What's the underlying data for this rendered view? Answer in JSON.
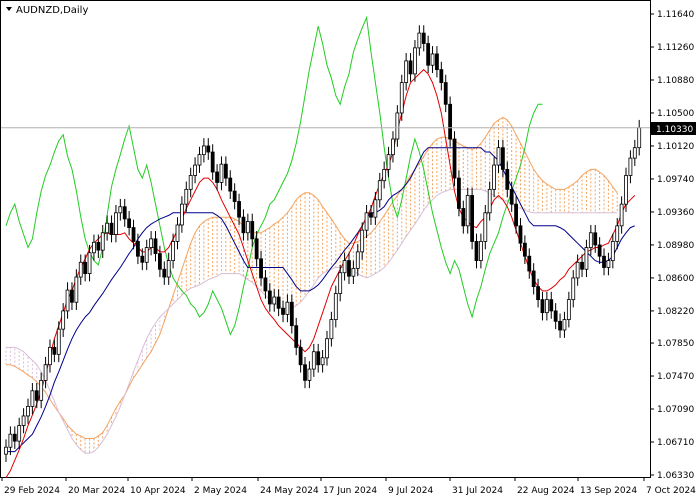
{
  "chart_data": {
    "type": "candlestick",
    "title": "AUDNZD,Daily",
    "current_price": "1.10330",
    "y_ticks": [
      "1.11640",
      "1.11260",
      "1.10880",
      "1.10500",
      "1.10120",
      "1.09740",
      "1.09360",
      "1.08980",
      "1.08600",
      "1.08220",
      "1.07850",
      "1.07470",
      "1.07090",
      "1.06710",
      "1.06330"
    ],
    "ylim": [
      1.0633,
      1.1164
    ],
    "x_ticks": [
      "29 Feb 2024",
      "20 Mar 2024",
      "10 Apr 2024",
      "2 May 2024",
      "24 May 2024",
      "17 Jun 2024",
      "9 Jul 2024",
      "31 Jul 2024",
      "22 Aug 2024",
      "13 Sep 2024",
      "7 Oct 2024"
    ],
    "closes": [
      1.0665,
      1.068,
      1.0672,
      1.069,
      1.0701,
      1.0712,
      1.073,
      1.0719,
      1.0742,
      1.076,
      1.078,
      1.0772,
      1.0801,
      1.0822,
      1.0846,
      1.0832,
      1.0861,
      1.0878,
      1.0865,
      1.0889,
      1.0901,
      1.0892,
      1.0912,
      1.0923,
      1.091,
      1.0935,
      1.0942,
      1.0928,
      1.0918,
      1.0902,
      1.0885,
      1.0878,
      1.0895,
      1.0905,
      1.0888,
      1.087,
      1.0861,
      1.088,
      1.0902,
      1.0921,
      1.0945,
      1.0962,
      1.0978,
      1.099,
      1.1002,
      1.1012,
      1.1005,
      1.0982,
      1.097,
      1.0991,
      1.0975,
      1.096,
      1.0948,
      1.093,
      1.0912,
      1.0925,
      1.0905,
      1.0882,
      1.086,
      1.0845,
      1.083,
      1.0838,
      1.0825,
      1.0818,
      1.0832,
      1.0805,
      1.078,
      1.076,
      1.0742,
      1.0755,
      1.0775,
      1.076,
      1.0768,
      1.079,
      1.0812,
      1.0842,
      1.0866,
      1.088,
      1.0862,
      1.0871,
      1.089,
      1.0915,
      1.0935,
      1.093,
      1.095,
      1.0972,
      1.0985,
      1.1002,
      1.102,
      1.105,
      1.1085,
      1.111,
      1.1095,
      1.1125,
      1.1142,
      1.113,
      1.1105,
      1.1118,
      1.11,
      1.1085,
      1.106,
      1.102,
      1.0975,
      1.094,
      1.092,
      1.0955,
      1.0902,
      1.088,
      1.0902,
      1.0935,
      1.0962,
      1.099,
      1.101,
      1.0985,
      1.0962,
      1.0945,
      1.092,
      1.09,
      1.0885,
      1.0868,
      1.085,
      1.0835,
      1.082,
      1.0835,
      1.0822,
      1.081,
      1.08,
      1.0812,
      1.0835,
      1.086,
      1.0878,
      1.087,
      1.0895,
      1.0912,
      1.0898,
      1.0885,
      1.0872,
      1.088,
      1.0902,
      1.092,
      1.0945,
      1.0978,
      1.0998,
      1.101,
      1.1033
    ],
    "tenkan": [
      1.063,
      1.0638,
      1.065,
      1.0662,
      1.0675,
      1.069,
      1.0702,
      1.0715,
      1.073,
      1.0748,
      1.077,
      1.079,
      1.0805,
      1.082,
      1.0835,
      1.0845,
      1.086,
      1.0872,
      1.0882,
      1.0893,
      1.09,
      1.0905,
      1.091,
      1.0912,
      1.091,
      1.091,
      1.091,
      1.0912,
      1.0905,
      1.09,
      1.0895,
      1.089,
      1.089,
      1.0895,
      1.0895,
      1.089,
      1.089,
      1.0895,
      1.0905,
      1.0915,
      1.0928,
      1.094,
      1.095,
      1.096,
      1.097,
      1.0975,
      1.0975,
      1.097,
      1.0962,
      1.095,
      1.094,
      1.093,
      1.092,
      1.091,
      1.0895,
      1.088,
      1.0865,
      1.085,
      1.0835,
      1.0825,
      1.0818,
      1.0812,
      1.0805,
      1.08,
      1.0795,
      1.079,
      1.0785,
      1.078,
      1.0775,
      1.078,
      1.079,
      1.0805,
      1.082,
      1.0835,
      1.085,
      1.086,
      1.087,
      1.088,
      1.0888,
      1.0898,
      1.091,
      1.092,
      1.093,
      1.094,
      1.0955,
      1.0968,
      1.098,
      1.099,
      1.1005,
      1.103,
      1.105,
      1.107,
      1.1085,
      1.109,
      1.1095,
      1.11,
      1.1095,
      1.1085,
      1.107,
      1.105,
      1.102,
      1.099,
      1.096,
      1.094,
      1.093,
      1.0925,
      1.092,
      1.0918,
      1.0925,
      1.093,
      1.094,
      1.095,
      1.0955,
      1.095,
      1.0942,
      1.093,
      1.0915,
      1.09,
      1.0885,
      1.087,
      1.0858,
      1.085,
      1.0845,
      1.0845,
      1.0848,
      1.0852,
      1.0858,
      1.0862,
      1.087,
      1.0875,
      1.088,
      1.0885,
      1.089,
      1.0892,
      1.0895,
      1.0895,
      1.0898,
      1.09,
      1.091,
      1.092,
      1.0935,
      1.0945,
      1.095,
      1.0955
    ],
    "kijun": [
      1.066,
      1.066,
      1.066,
      1.0665,
      1.067,
      1.0675,
      1.068,
      1.069,
      1.07,
      1.0712,
      1.0725,
      1.074,
      1.0752,
      1.0765,
      1.0778,
      1.079,
      1.08,
      1.0808,
      1.0815,
      1.082,
      1.0828,
      1.0835,
      1.0842,
      1.085,
      1.0858,
      1.0865,
      1.0872,
      1.088,
      1.0888,
      1.0895,
      1.0905,
      1.0912,
      1.0918,
      1.0922,
      1.0925,
      1.0928,
      1.093,
      1.0932,
      1.0935,
      1.0935,
      1.0935,
      1.0935,
      1.0935,
      1.0935,
      1.0935,
      1.0935,
      1.0935,
      1.0935,
      1.0932,
      1.0928,
      1.092,
      1.091,
      1.09,
      1.089,
      1.088,
      1.0872,
      1.0872,
      1.0872,
      1.0872,
      1.0872,
      1.0872,
      1.0872,
      1.0872,
      1.0872,
      1.0865,
      1.0858,
      1.085,
      1.0845,
      1.0845,
      1.0845,
      1.0848,
      1.0852,
      1.0858,
      1.0865,
      1.0872,
      1.0878,
      1.0885,
      1.0892,
      1.0898,
      1.0905,
      1.0912,
      1.092,
      1.093,
      1.0935,
      1.0935,
      1.0938,
      1.0942,
      1.095,
      1.0955,
      1.0958,
      1.0962,
      1.0968,
      1.0975,
      1.0985,
      1.0995,
      1.1005,
      1.101,
      1.101,
      1.101,
      1.101,
      1.101,
      1.101,
      1.101,
      1.101,
      1.101,
      1.101,
      1.101,
      1.101,
      1.101,
      1.1005,
      1.1005,
      1.1,
      1.0995,
      1.0985,
      1.0975,
      1.0965,
      1.0955,
      1.0945,
      1.0935,
      1.0925,
      1.092,
      1.092,
      1.092,
      1.092,
      1.092,
      1.092,
      1.0918,
      1.0915,
      1.091,
      1.0905,
      1.09,
      1.0895,
      1.089,
      1.0885,
      1.088,
      1.0878,
      1.0878,
      1.088,
      1.0885,
      1.0895,
      1.0905,
      1.0912,
      1.0918,
      1.092
    ],
    "chikou": [
      1.092,
      1.0935,
      1.0945,
      1.0925,
      1.091,
      1.0895,
      1.0905,
      1.0935,
      1.096,
      1.0978,
      1.099,
      1.1005,
      1.1018,
      1.1025,
      1.1,
      1.0985,
      1.096,
      1.093,
      1.0905,
      1.089,
      1.088,
      1.0875,
      1.0895,
      1.0932,
      1.0965,
      1.0985,
      1.1002,
      1.102,
      1.1035,
      1.101,
      1.0985,
      1.0975,
      1.099,
      1.097,
      1.0945,
      1.092,
      1.0895,
      1.0875,
      1.086,
      1.0852,
      1.0845,
      1.084,
      1.083,
      1.0825,
      1.0815,
      1.082,
      1.083,
      1.0845,
      1.0835,
      1.0825,
      1.081,
      1.0795,
      1.0805,
      1.0825,
      1.085,
      1.087,
      1.0895,
      1.091,
      1.092,
      1.093,
      1.0945,
      1.095,
      1.096,
      1.097,
      1.098,
      1.0995,
      1.1015,
      1.104,
      1.107,
      1.11,
      1.1125,
      1.115,
      1.113,
      1.1105,
      1.109,
      1.107,
      1.106,
      1.108,
      1.1095,
      1.112,
      1.1135,
      1.1148,
      1.116,
      1.112,
      1.1085,
      1.105,
      1.101,
      1.0975,
      1.0945,
      1.093,
      1.095,
      1.0975,
      1.1,
      1.102,
      1.1005,
      1.0985,
      1.096,
      1.0935,
      1.0915,
      1.0895,
      1.0878,
      1.0865,
      1.088,
      1.087,
      1.085,
      1.083,
      1.0815,
      1.0835,
      1.085,
      1.087,
      1.0888,
      1.09,
      1.0912,
      1.093,
      1.0945,
      1.096,
      1.0975,
      1.099,
      1.101,
      1.1035,
      1.105,
      1.106,
      1.106
    ],
    "senkou_a": [
      1.076,
      1.076,
      1.0758,
      1.0755,
      1.0752,
      1.0748,
      1.0745,
      1.074,
      1.0735,
      1.0728,
      1.072,
      1.0712,
      1.0705,
      1.0698,
      1.069,
      1.0685,
      1.068,
      1.0678,
      1.0675,
      1.0675,
      1.0675,
      1.0678,
      1.0682,
      1.069,
      1.07,
      1.071,
      1.0718,
      1.0725,
      1.0735,
      1.0745,
      1.0752,
      1.076,
      1.0768,
      1.0775,
      1.0785,
      1.0795,
      1.081,
      1.0825,
      1.084,
      1.0855,
      1.087,
      1.0885,
      1.09,
      1.0912,
      1.092,
      1.0925,
      1.0928,
      1.093,
      1.093,
      1.093,
      1.093,
      1.093,
      1.0928,
      1.0925,
      1.092,
      1.0915,
      1.0912,
      1.0912,
      1.0912,
      1.0915,
      1.0918,
      1.0922,
      1.0925,
      1.093,
      1.0935,
      1.0942,
      1.095,
      1.0955,
      1.0958,
      1.0958,
      1.0955,
      1.095,
      1.0942,
      1.0935,
      1.0928,
      1.092,
      1.0912,
      1.0905,
      1.09,
      1.09,
      1.0902,
      1.0905,
      1.0908,
      1.0912,
      1.0918,
      1.0925,
      1.0932,
      1.094,
      1.0948,
      1.0955,
      1.0962,
      1.097,
      1.0978,
      1.0985,
      1.0992,
      1.1,
      1.1008,
      1.1015,
      1.102,
      1.1022,
      1.1022,
      1.102,
      1.1018,
      1.1015,
      1.1012,
      1.101,
      1.1008,
      1.101,
      1.1015,
      1.1022,
      1.103,
      1.1038,
      1.1042,
      1.1045,
      1.1042,
      1.1035,
      1.1025,
      1.1015,
      1.1005,
      1.0995,
      1.0985,
      1.0978,
      1.0972,
      1.0968,
      1.0965,
      1.0962,
      1.0962,
      1.0962,
      1.0965,
      1.0968,
      1.0972,
      1.0978,
      1.0982,
      1.0985,
      1.0985,
      1.0982,
      1.0978,
      1.0972,
      1.0965,
      1.0958
    ],
    "senkou_b": [
      1.078,
      1.078,
      1.078,
      1.0778,
      1.0775,
      1.077,
      1.0765,
      1.076,
      1.0752,
      1.0742,
      1.073,
      1.0718,
      1.0705,
      1.0695,
      1.0685,
      1.0675,
      1.0668,
      1.0662,
      1.0658,
      1.0658,
      1.066,
      1.0665,
      1.0672,
      1.068,
      1.069,
      1.07,
      1.0712,
      1.0725,
      1.0738,
      1.0752,
      1.0765,
      1.0778,
      1.079,
      1.08,
      1.0808,
      1.0815,
      1.082,
      1.0825,
      1.083,
      1.0835,
      1.084,
      1.0845,
      1.0848,
      1.085,
      1.0852,
      1.0855,
      1.0858,
      1.086,
      1.0862,
      1.0865,
      1.0865,
      1.0865,
      1.0865,
      1.0865,
      1.0862,
      1.0858,
      1.0855,
      1.085,
      1.0845,
      1.084,
      1.0835,
      1.083,
      1.0828,
      1.0825,
      1.0825,
      1.0825,
      1.0828,
      1.0832,
      1.0838,
      1.0845,
      1.0852,
      1.086,
      1.0865,
      1.0868,
      1.087,
      1.0872,
      1.0872,
      1.0872,
      1.087,
      1.0868,
      1.0865,
      1.0862,
      1.086,
      1.0862,
      1.0865,
      1.0868,
      1.0872,
      1.0878,
      1.0885,
      1.0892,
      1.09,
      1.0908,
      1.0915,
      1.0922,
      1.093,
      1.0938,
      1.0945,
      1.095,
      1.0955,
      1.0958,
      1.096,
      1.0962,
      1.0962,
      1.0962,
      1.0962,
      1.0962,
      1.0962,
      1.0962,
      1.0962,
      1.096,
      1.0958,
      1.0955,
      1.0952,
      1.095,
      1.0948,
      1.0945,
      1.0942,
      1.094,
      1.0938,
      1.0936,
      1.0935,
      1.0935,
      1.0935,
      1.0935,
      1.0935,
      1.0935,
      1.0935,
      1.0935,
      1.0935,
      1.0935,
      1.0935,
      1.0935,
      1.0935,
      1.0935,
      1.0935,
      1.0935,
      1.0935,
      1.0935,
      1.0935,
      1.0935
    ],
    "colors": {
      "up_candle": "#ffffff",
      "down_candle": "#000000",
      "tenkan": "#e00000",
      "kijun": "#00008b",
      "chikou": "#22cc22",
      "cloud_bull": "#f4a460",
      "cloud_bear": "#d8bfd8",
      "grid": "#cccccc",
      "axis": "#000000",
      "price_label_bg": "#000000",
      "price_label_text": "#ffffff"
    }
  }
}
